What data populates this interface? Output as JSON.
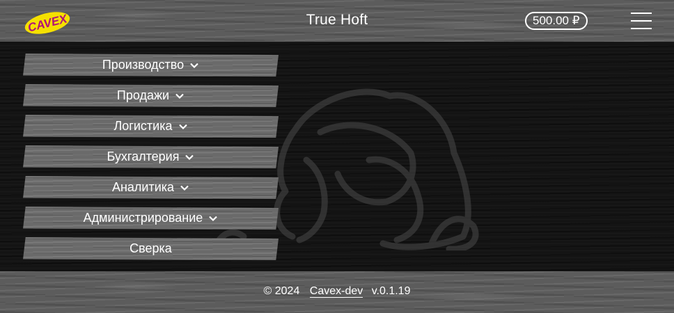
{
  "header": {
    "logo_text": "CAVEX",
    "title": "True Hoft",
    "balance": "500.00 ₽",
    "menu_icon": "hamburger-icon"
  },
  "menu": {
    "items": [
      {
        "label": "Производство",
        "has_dropdown": true
      },
      {
        "label": "Продажи",
        "has_dropdown": true
      },
      {
        "label": "Логистика",
        "has_dropdown": true
      },
      {
        "label": "Бухгалтерия",
        "has_dropdown": true
      },
      {
        "label": "Аналитика",
        "has_dropdown": true
      },
      {
        "label": "Администрирование",
        "has_dropdown": true
      },
      {
        "label": "Сверка",
        "has_dropdown": false
      }
    ]
  },
  "footer": {
    "copyright": "© 2024",
    "link_label": "Cavex-dev",
    "version": "v.0.1.19"
  },
  "colors": {
    "logo_fill": "#f5e000",
    "logo_text": "#b0127a",
    "wood": "#5c5c5c",
    "background": "#141414"
  }
}
